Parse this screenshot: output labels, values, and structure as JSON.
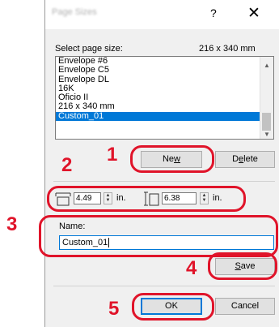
{
  "dialog": {
    "title": "Page Sizes",
    "help_glyph": "?",
    "close_glyph": "✕"
  },
  "select": {
    "label": "Select page size:",
    "size_value": "216 x 340 mm",
    "items": [
      "Envelope #6",
      "Envelope C5",
      "Envelope DL",
      "16K",
      "Oficio II",
      "216 x 340 mm",
      "Custom_01"
    ],
    "selected_index": 6
  },
  "buttons": {
    "new": "New",
    "delete": "Delete",
    "save": "Save",
    "ok": "OK",
    "cancel": "Cancel"
  },
  "dimensions": {
    "width_value": "4.49",
    "height_value": "6.38",
    "width_unit": "in.",
    "height_unit": "in."
  },
  "name": {
    "label": "Name:",
    "value": "Custom_01"
  },
  "callouts": {
    "n1": "1",
    "n2": "2",
    "n3": "3",
    "n4": "4",
    "n5": "5"
  },
  "colors": {
    "accent": "#0078d7",
    "callout_red": "#e0142a"
  }
}
